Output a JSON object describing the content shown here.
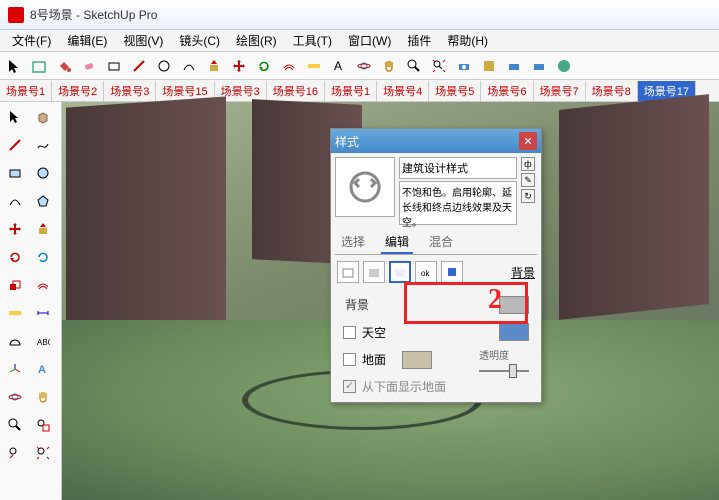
{
  "window": {
    "title": "8号场景 - SketchUp Pro"
  },
  "menus": {
    "file": "文件(F)",
    "edit": "编辑(E)",
    "view": "视图(V)",
    "camera": "镜头(C)",
    "draw": "绘图(R)",
    "tools": "工具(T)",
    "window": "窗口(W)",
    "plugins": "插件",
    "help": "帮助(H)"
  },
  "scenes": {
    "items": [
      "场景号1",
      "场景号2",
      "场景号3",
      "场景号15",
      "场景号3",
      "场景号16",
      "场景号1",
      "场景号4",
      "场景号5",
      "场景号6",
      "场景号7",
      "场景号8",
      "场景号17"
    ],
    "active_index": 12
  },
  "styles_dialog": {
    "title": "样式",
    "style_name": "建筑设计样式",
    "style_desc": "不饱和色。启用轮廓、延长线和终点边线效果及天空。",
    "tabs": {
      "select": "选择",
      "edit": "编辑",
      "mix": "混合",
      "active": 1
    },
    "bg_label_right": "背景",
    "section": "背景",
    "rows": {
      "sky": {
        "label": "天空",
        "checked": false,
        "color": "#5a8ac8"
      },
      "ground": {
        "label": "地面",
        "checked": false,
        "color": "#c8c0a8",
        "opacity_label": "透明度"
      },
      "show_below": {
        "label": "从下面显示地面",
        "checked": true,
        "disabled": true
      }
    },
    "bg_swatch": "#b8b8b8"
  },
  "annotation": {
    "number": "2"
  },
  "colors": {
    "accent": "#3366cc",
    "red": "#e22222"
  }
}
